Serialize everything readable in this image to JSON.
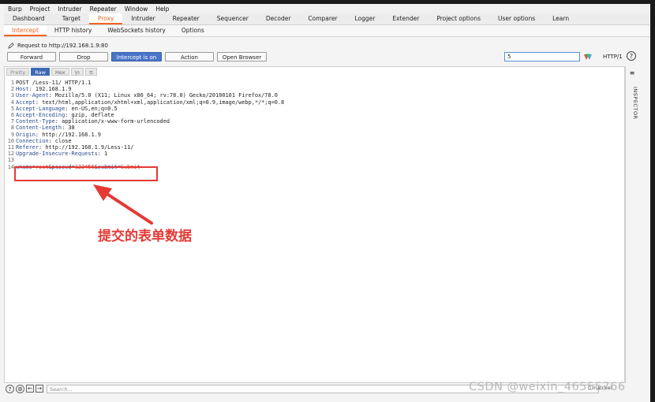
{
  "menu": [
    "Burp",
    "Project",
    "Intruder",
    "Repeater",
    "Window",
    "Help"
  ],
  "main_tabs": [
    {
      "label": "Dashboard"
    },
    {
      "label": "Target"
    },
    {
      "label": "Proxy",
      "active": true
    },
    {
      "label": "Intruder"
    },
    {
      "label": "Repeater"
    },
    {
      "label": "Sequencer"
    },
    {
      "label": "Decoder"
    },
    {
      "label": "Comparer"
    },
    {
      "label": "Logger"
    },
    {
      "label": "Extender"
    },
    {
      "label": "Project options"
    },
    {
      "label": "User options"
    },
    {
      "label": "Learn"
    }
  ],
  "sub_tabs": [
    {
      "label": "Intercept",
      "active": true
    },
    {
      "label": "HTTP history"
    },
    {
      "label": "WebSockets history"
    },
    {
      "label": "Options"
    }
  ],
  "request_to": "Request to http://192.168.1.9:80",
  "toolbar": {
    "forward": "Forward",
    "drop": "Drop",
    "intercept": "Intercept is on",
    "action": "Action",
    "open_browser": "Open Browser",
    "search_value": "5",
    "http_version": "HTTP/1",
    "help": "?"
  },
  "view_tabs": [
    "Pretty",
    "Raw",
    "Hex",
    "\\n"
  ],
  "view_tabs_active": "Raw",
  "request_lines": [
    {
      "n": "1",
      "text": "POST /Less-11/ HTTP/1.1"
    },
    {
      "n": "2",
      "key": "Host",
      "val": " 192.168.1.9"
    },
    {
      "n": "3",
      "key": "User-Agent",
      "val": " Mozilla/5.0 (X11; Linux x86_64; rv:78.0) Gecko/20100101 Firefox/78.0"
    },
    {
      "n": "4",
      "key": "Accept",
      "val": " text/html,application/xhtml+xml,application/xml;q=0.9,image/webp,*/*;q=0.8"
    },
    {
      "n": "5",
      "key": "Accept-Language",
      "val": " en-US,en;q=0.5"
    },
    {
      "n": "6",
      "key": "Accept-Encoding",
      "val": " gzip, deflate"
    },
    {
      "n": "7",
      "key": "Content-Type",
      "val": " application/x-www-form-urlencoded"
    },
    {
      "n": "8",
      "key": "Content-Length",
      "val": " 38"
    },
    {
      "n": "9",
      "key": "Origin",
      "val": " http://192.168.1.9"
    },
    {
      "n": "10",
      "key": "Connection",
      "val": " close"
    },
    {
      "n": "11",
      "key": "Referer",
      "val": " http://192.168.1.9/Less-11/"
    },
    {
      "n": "12",
      "key": "Upgrade-Insecure-Requests",
      "val": " 1"
    },
    {
      "n": "13",
      "text": ""
    }
  ],
  "body_line": {
    "n": "14",
    "params": [
      {
        "k": "uname",
        "v": "root"
      },
      {
        "k": "passwd",
        "v": "123456"
      },
      {
        "k": "submit",
        "v": "Submit"
      }
    ]
  },
  "annotation": "提交的表单数据",
  "inspector_label": "INSPECTOR",
  "bottom": {
    "search_placeholder": "Search...",
    "matches": "0 matches"
  },
  "watermark": "CSDN @weixin_46555766",
  "colors": {
    "accent": "#f26522",
    "intercept_on": "#4a74c9",
    "highlight": "#e53935"
  }
}
